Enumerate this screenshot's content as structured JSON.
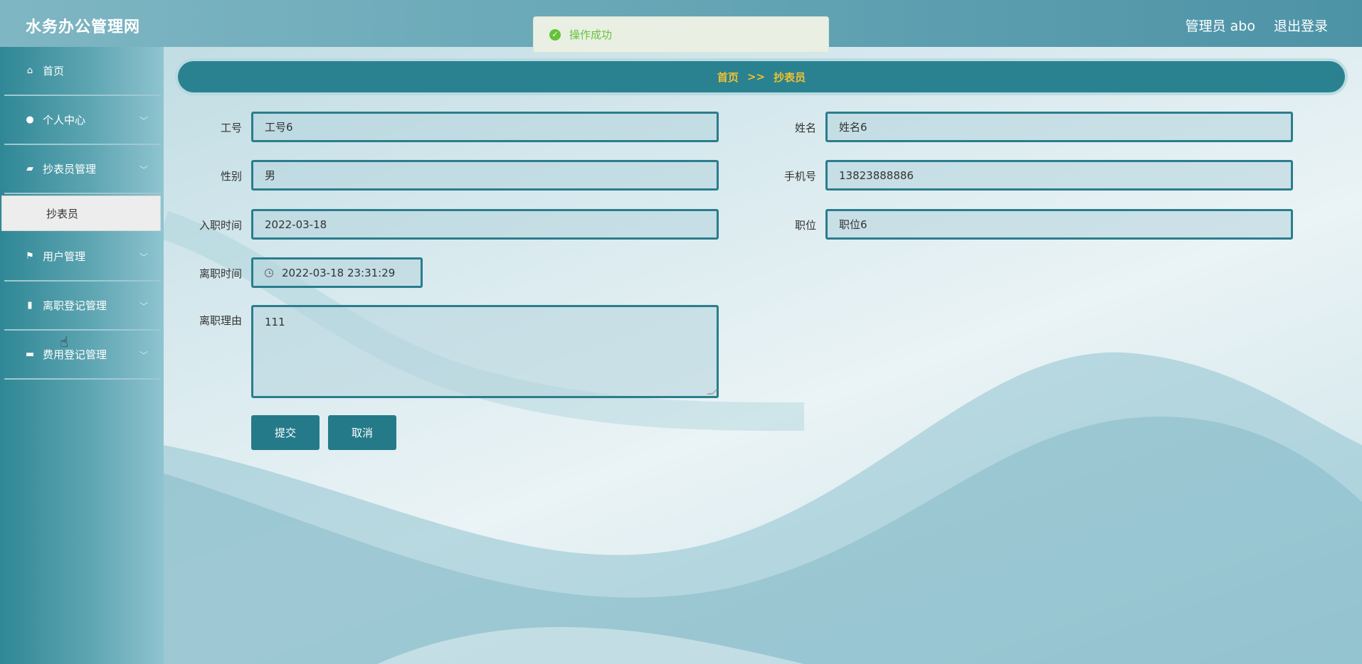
{
  "header": {
    "app_title": "水务办公管理网",
    "admin_label": "管理员 abo",
    "logout_label": "退出登录"
  },
  "toast": {
    "message": "操作成功",
    "icon": "check-circle-icon"
  },
  "sidebar": {
    "items": [
      {
        "label": "首页",
        "icon": "home-icon"
      },
      {
        "label": "个人中心",
        "icon": "user-icon"
      },
      {
        "label": "抄表员管理",
        "icon": "ticket-icon"
      },
      {
        "label": "用户管理",
        "icon": "flag-icon"
      },
      {
        "label": "离职登记管理",
        "icon": "book-icon"
      },
      {
        "label": "费用登记管理",
        "icon": "card-icon"
      }
    ],
    "active_sub": "抄表员"
  },
  "breadcrumb": {
    "home": "首页",
    "sep": ">>",
    "current": "抄表员"
  },
  "form": {
    "job_no": {
      "label": "工号",
      "value": "工号6"
    },
    "name": {
      "label": "姓名",
      "value": "姓名6"
    },
    "gender": {
      "label": "性别",
      "value": "男"
    },
    "phone": {
      "label": "手机号",
      "value": "13823888886"
    },
    "hire_date": {
      "label": "入职时间",
      "value": "2022-03-18"
    },
    "position": {
      "label": "职位",
      "value": "职位6"
    },
    "leave_time": {
      "label": "离职时间",
      "value": "2022-03-18 23:31:29"
    },
    "leave_reason": {
      "label": "离职理由",
      "value": "111"
    }
  },
  "buttons": {
    "submit": "提交",
    "cancel": "取消"
  },
  "colors": {
    "primary": "#257a8a",
    "breadcrumb_text": "#f2c12e",
    "toast_text": "#67c23a"
  }
}
